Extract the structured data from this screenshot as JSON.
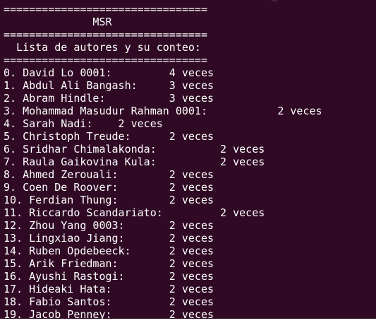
{
  "terminal": {
    "lines": [
      "================================",
      "              MSR",
      "================================",
      "  Lista de autores y su conteo:",
      "================================",
      "0. David Lo 0001:         4 veces",
      "1. Abdul Ali Bangash:     3 veces",
      "2. Abram Hindle:          3 veces",
      "3. Mohammad Masudur Rahman 0001:           2 veces",
      "4. Sarah Nadi:    2 veces",
      "5. Christoph Treude:      2 veces",
      "6. Sridhar Chimalakonda:          2 veces",
      "7. Raula Gaikovina Kula:          2 veces",
      "8. Ahmed Zerouali:        2 veces",
      "9. Coen De Roover:        2 veces",
      "10. Ferdian Thung:        2 veces",
      "11. Riccardo Scandariato:         2 veces",
      "12. Zhou Yang 0003:       2 veces",
      "13. Lingxiao Jiang:       2 veces",
      "14. Ruben Opdebeeck:      2 veces",
      "15. Arik Friedman:        2 veces",
      "16. Ayushi Rastogi:       2 veces",
      "17. Hideaki Hata:         2 veces",
      "18. Fabio Santos:         2 veces",
      "19. Jacob Penney:         2 veces"
    ]
  }
}
